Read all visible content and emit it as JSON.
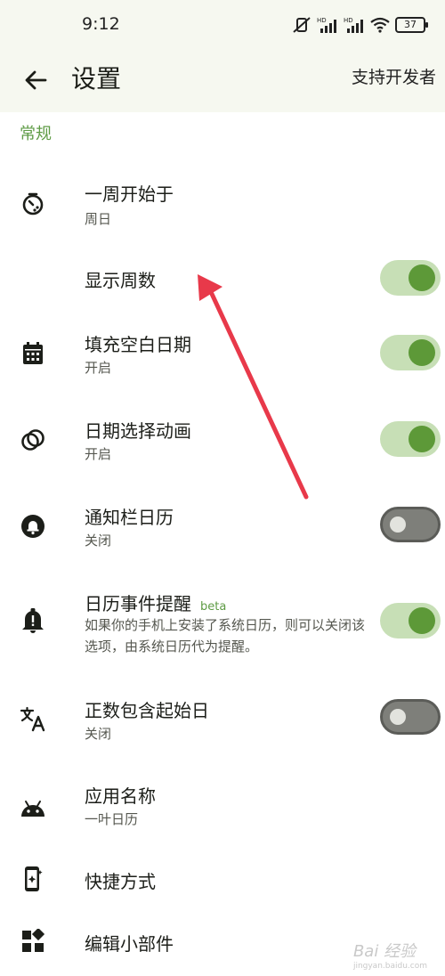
{
  "status": {
    "time": "9:12",
    "battery": "37"
  },
  "appbar": {
    "title": "设置",
    "support": "支持开发者"
  },
  "section": {
    "general": "常规"
  },
  "items": [
    {
      "title": "一周开始于",
      "subtitle": "周日",
      "icon": "timer-icon"
    },
    {
      "title": "显示周数",
      "switch": "on"
    },
    {
      "title": "填充空白日期",
      "subtitle": "开启",
      "icon": "calendar-grid-icon",
      "switch": "on"
    },
    {
      "title": "日期选择动画",
      "subtitle": "开启",
      "icon": "rings-icon",
      "switch": "on"
    },
    {
      "title": "通知栏日历",
      "subtitle": "关闭",
      "icon": "bell-circle-icon",
      "switch": "off"
    },
    {
      "title": "日历事件提醒",
      "badge": "beta",
      "subtitle": "如果你的手机上安装了系统日历，则可以关闭该选项，由系统日历代为提醒。",
      "icon": "bell-alert-icon",
      "switch": "on"
    },
    {
      "title": "正数包含起始日",
      "subtitle": "关闭",
      "icon": "translate-icon",
      "switch": "off"
    },
    {
      "title": "应用名称",
      "subtitle": "一叶日历",
      "icon": "android-icon"
    },
    {
      "title": "快捷方式",
      "icon": "shortcut-icon"
    },
    {
      "title": "编辑小部件",
      "icon": "widgets-icon"
    }
  ],
  "watermark": {
    "main": "Bai 经验",
    "sub": "jingyan.baidu.com"
  },
  "colors": {
    "accent": "#5d9938",
    "annotation_arrow": "#e8394a"
  }
}
